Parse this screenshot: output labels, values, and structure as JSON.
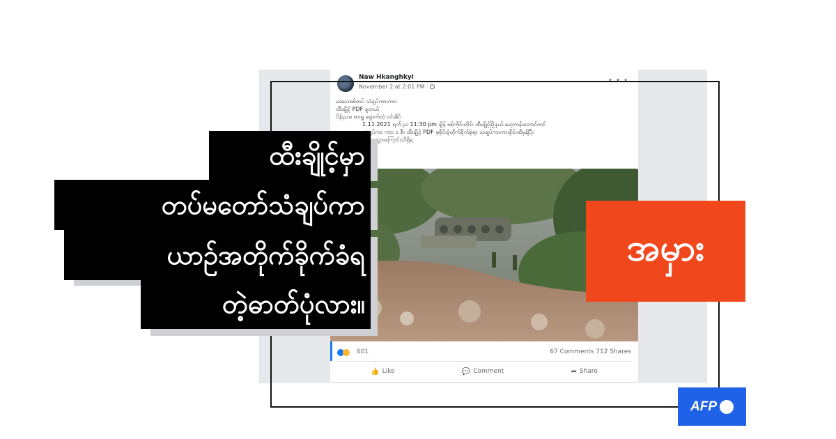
{
  "post": {
    "poster_name": "Naw Hkanghkyi",
    "date": "November 2 at 2:01 PM ·",
    "text_lines": [
      "မအလစစ်တပ် သံချပ်ကားကား",
      "ထီးချိုင့် PDF ခွတယ်",
      "ပိန်းညစ စားရှူ ရှောက်ထဲ ဝင်အိပ်",
      "1.11.2021 ရက် ည 11:30 pm ချိန် စစ်ကိုင်းတိုင်း ထီးချိုင့်မြို့နယ် မော့ကန်းတောင်တင်",
      "သံချပ်ကာ ကား ၁ စီး ထီးချိုင့် PDF မှခိုင်းခဲ့တိုက်ခိုက်ခဲ့ရာ သံချပ်ကာကားခိုင်းထိမှန်ပြီး",
      "ထိုးကျသွားကြောင်းသိရှိရ"
    ],
    "reaction_count": "601",
    "comments": "67 Comments",
    "shares": "712 Shares",
    "actions": {
      "like": "Like",
      "comment": "Comment",
      "share": "Share"
    }
  },
  "headline": {
    "lines": [
      "ထီးချိုင့်မှာ",
      "တပ်မတော်သံချပ်ကာ",
      "ယာဉ်အတိုက်ခိုက်ခံရ",
      "တဲ့ဓာတ်ပုံလား။"
    ]
  },
  "verdict": {
    "label": "အမှား",
    "color": "#f1471d"
  },
  "logo": {
    "text": "AFP",
    "color": "#1f62e8"
  },
  "icons": [
    "globe-icon",
    "more-icon",
    "like-reaction-icon",
    "haha-reaction-icon",
    "like-icon",
    "comment-icon",
    "share-icon",
    "afp-logo"
  ]
}
